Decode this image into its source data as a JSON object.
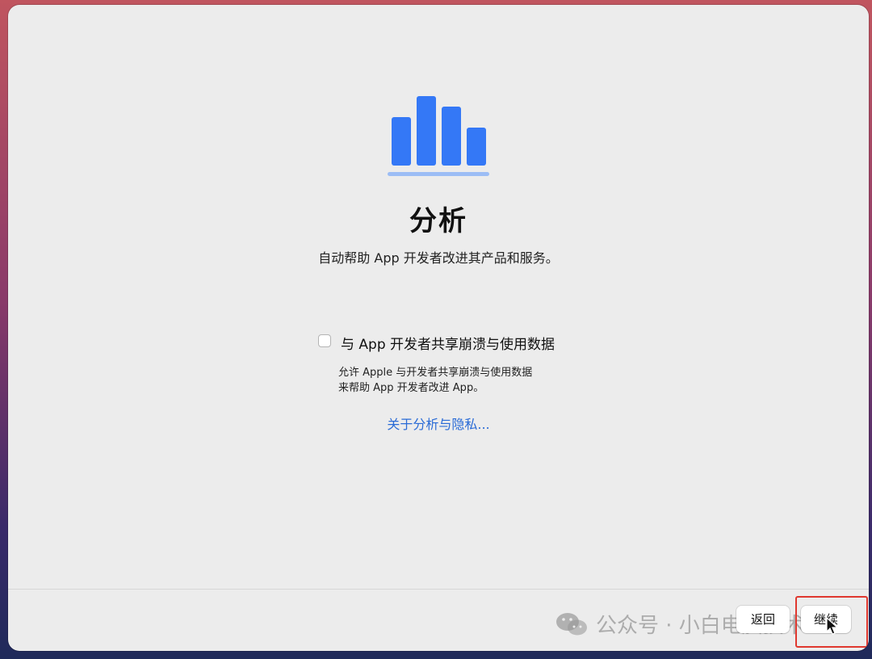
{
  "page": {
    "title": "分析",
    "subtitle": "自动帮助 App 开发者改进其产品和服务。"
  },
  "option": {
    "label": "与 App 开发者共享崩溃与使用数据",
    "checked": false,
    "description_line1": "允许 Apple 与开发者共享崩溃与使用数据",
    "description_line2": "来帮助 App 开发者改进 App。"
  },
  "link": {
    "label": "关于分析与隐私..."
  },
  "footer": {
    "back_label": "返回",
    "continue_label": "继续"
  },
  "watermark": {
    "text": "公众号 · 小白电脑技术"
  },
  "icons": {
    "hero": "bar-chart-icon",
    "checkbox": "checkbox-icon",
    "cursor": "mouse-pointer-icon",
    "watermark": "wechat-icon"
  },
  "colors": {
    "accent": "#3478f6",
    "link": "#2a6bd6",
    "highlight_box": "#e0382f"
  }
}
